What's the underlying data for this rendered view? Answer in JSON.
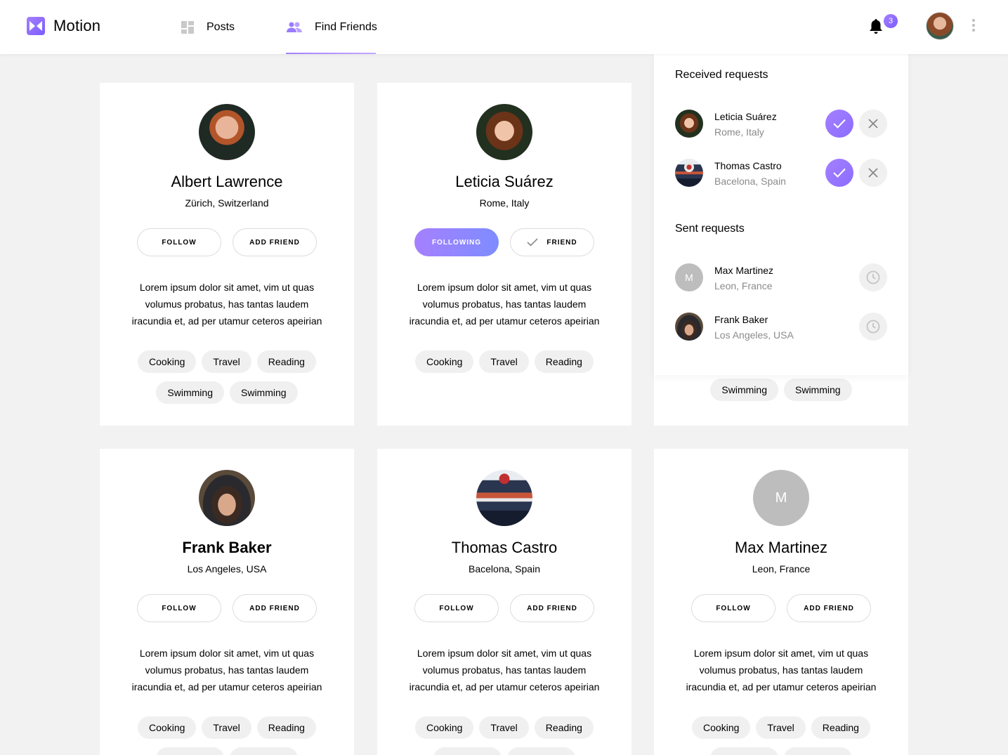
{
  "app": {
    "name": "Motion"
  },
  "nav": {
    "posts": "Posts",
    "find_friends": "Find Friends"
  },
  "notifications": {
    "count": "3"
  },
  "panel": {
    "received_title": "Received requests",
    "received": [
      {
        "name": "Leticia Suárez",
        "location": "Rome, Italy"
      },
      {
        "name": "Thomas Castro",
        "location": "Bacelona, Spain"
      }
    ],
    "sent_title": "Sent requests",
    "sent": [
      {
        "name": "Max Martinez",
        "location": "Leon, France",
        "initial": "M"
      },
      {
        "name": "Frank Baker",
        "location": "Los Angeles, USA"
      }
    ]
  },
  "buttons": {
    "follow": "FOLLOW",
    "following": "FOLLOWING",
    "add_friend": "ADD FRIEND",
    "friend": "FRIEND"
  },
  "bio": "Lorem ipsum dolor sit amet, vim ut quas volumus probatus, has tantas laudem iracundia et, ad per utamur ceteros apeirian",
  "tags": [
    "Cooking",
    "Travel",
    "Reading",
    "Swimming",
    "Swimming"
  ],
  "cards": [
    {
      "name": "Albert Lawrence",
      "location": "Zürich, Switzerland"
    },
    {
      "name": "Leticia Suárez",
      "location": "Rome, Italy"
    },
    {
      "name": "Frank Baker",
      "location": "Los Angeles, USA"
    },
    {
      "name": "Thomas Castro",
      "location": "Bacelona, Spain"
    },
    {
      "name": "Max Martinez",
      "location": "Leon, France",
      "initial": "M"
    }
  ],
  "colors": {
    "accent": "#a580ff",
    "accent_dark": "#7b5cff",
    "bg": "#f2f2f2"
  }
}
